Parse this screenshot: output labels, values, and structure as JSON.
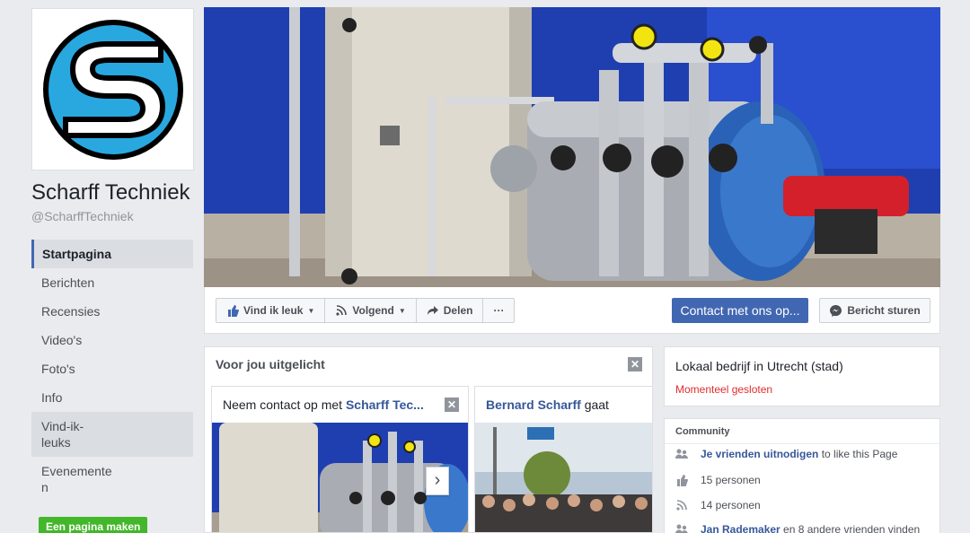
{
  "page": {
    "name": "Scharff Techniek",
    "handle": "@ScharffTechniek"
  },
  "nav": {
    "items": [
      {
        "label": "Startpagina"
      },
      {
        "label": "Berichten"
      },
      {
        "label": "Recensies"
      },
      {
        "label": "Video's"
      },
      {
        "label": "Foto's"
      },
      {
        "label": "Info"
      },
      {
        "label": "Vind-ik-\nleuks"
      },
      {
        "label": "Evenemente\nn"
      }
    ],
    "create_page": "Een pagina maken"
  },
  "actions": {
    "like": "Vind ik leuk",
    "follow": "Volgend",
    "share": "Delen",
    "more": "···",
    "contact": "Contact met ons op...",
    "message": "Bericht sturen"
  },
  "featured": {
    "title": "Voor jou uitgelicht",
    "card1_prefix": "Neem contact op met ",
    "card1_name": "Scharff Tec...",
    "card2_name": "Bernard Scharff",
    "card2_suffix": " gaat"
  },
  "business": {
    "type": "Lokaal bedrijf in Utrecht (stad)",
    "status": "Momenteel gesloten"
  },
  "community": {
    "title": "Community",
    "invite_link": "Je vrienden uitnodigen",
    "invite_suffix": " to like this Page",
    "likes": "15 personen",
    "follows": "14 personen",
    "friends_link": "Jan Rademaker",
    "friends_suffix": " en 8 andere vrienden vinden"
  },
  "colors": {
    "brand_blue": "#4267b2",
    "link_blue": "#365899",
    "status_red": "#e02d2d",
    "create_green": "#42b72a"
  }
}
